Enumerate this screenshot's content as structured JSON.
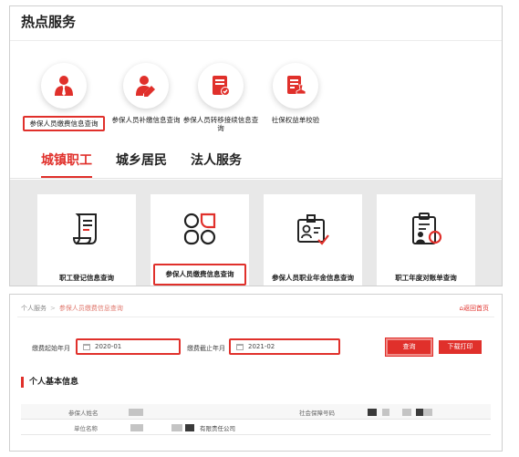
{
  "hot": {
    "title": "热点服务",
    "services": [
      {
        "label": "参保人员缴费信息查询",
        "icon": "user-tie-icon"
      },
      {
        "label": "参保人员补缴信息查询",
        "icon": "user-edit-icon"
      },
      {
        "label": "参保人员转移接续信息查询",
        "icon": "document-check-icon"
      },
      {
        "label": "社保权益单校验",
        "icon": "document-stamp-icon"
      }
    ]
  },
  "tabs": [
    {
      "label": "城镇职工"
    },
    {
      "label": "城乡居民"
    },
    {
      "label": "法人服务"
    }
  ],
  "cards": [
    {
      "label": "职工登记信息查询",
      "icon": "scroll-icon"
    },
    {
      "label": "参保人员缴费信息查询",
      "icon": "grid-cells-icon"
    },
    {
      "label": "参保人员职业年金信息查询",
      "icon": "id-card-check-icon"
    },
    {
      "label": "职工年度对账单查询",
      "icon": "clipboard-person-icon"
    }
  ],
  "breadcrumb": {
    "root": "个人服务",
    "current": "参保人员缴费信息查询"
  },
  "back_home": "返回首页",
  "form": {
    "start_label": "缴费起始年月",
    "start_value": "2020-01",
    "end_label": "缴费截止年月",
    "end_value": "2021-02",
    "query_button": "查询",
    "print_button": "下载打印"
  },
  "section": {
    "title": "个人基本信息"
  },
  "info": {
    "name_label": "参保人姓名",
    "ssn_label": "社会保障号码",
    "unit_label": "单位名称",
    "unit_suffix": "有限责任公司"
  },
  "colors": {
    "accent": "#e0302b",
    "card_bg": "#e8e8e8"
  }
}
